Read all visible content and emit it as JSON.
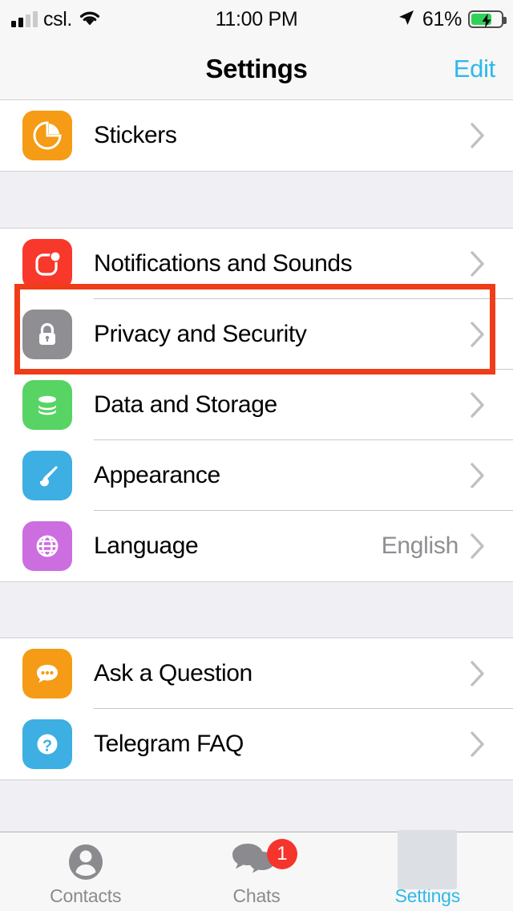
{
  "status_bar": {
    "carrier": "csl.",
    "signal_bars_filled": 2,
    "signal_bars_total": 4,
    "wifi_icon": "wifi-icon",
    "time": "11:00 PM",
    "location_icon": "location-arrow-icon",
    "battery_percent": "61%",
    "battery_level": 61,
    "battery_charging": true,
    "battery_color": "#30D158"
  },
  "nav": {
    "title": "Settings",
    "edit_label": "Edit",
    "accent_color": "#2EB9E8"
  },
  "sections": [
    {
      "rows": [
        {
          "icon": "sticker-icon",
          "icon_color": "#F59B15",
          "label": "Stickers",
          "detail": "",
          "accessory": "chevron-right-icon"
        }
      ]
    },
    {
      "rows": [
        {
          "icon": "notification-bell-icon",
          "icon_color": "#F8382B",
          "label": "Notifications and Sounds",
          "detail": "",
          "accessory": "chevron-right-icon"
        },
        {
          "icon": "lock-icon",
          "icon_color": "#8E8E93",
          "label": "Privacy and Security",
          "detail": "",
          "accessory": "chevron-right-icon"
        },
        {
          "icon": "database-icon",
          "icon_color": "#57D463",
          "label": "Data and Storage",
          "detail": "",
          "accessory": "chevron-right-icon"
        },
        {
          "icon": "paintbrush-icon",
          "icon_color": "#3DAFE3",
          "label": "Appearance",
          "detail": "",
          "accessory": "chevron-right-icon"
        },
        {
          "icon": "globe-icon",
          "icon_color": "#CC6EE0",
          "label": "Language",
          "detail": "English",
          "accessory": "chevron-right-icon"
        }
      ]
    },
    {
      "rows": [
        {
          "icon": "chat-bubble-icon",
          "icon_color": "#F59B15",
          "label": "Ask a Question",
          "detail": "",
          "accessory": "chevron-right-icon"
        },
        {
          "icon": "question-mark-icon",
          "icon_color": "#3DAFE3",
          "label": "Telegram FAQ",
          "detail": "",
          "accessory": "chevron-right-icon"
        }
      ]
    }
  ],
  "highlight": {
    "target_row": "Privacy and Security",
    "color": "#F03C18"
  },
  "tab_bar": {
    "tabs": [
      {
        "icon": "person-icon",
        "label": "Contacts",
        "active": false,
        "badge": ""
      },
      {
        "icon": "chats-bubbles-icon",
        "label": "Chats",
        "active": false,
        "badge": "1"
      },
      {
        "icon": "gear-icon",
        "label": "Settings",
        "active": true,
        "badge": ""
      }
    ],
    "active_color": "#2EB9E8",
    "inactive_color": "#8A8A8F",
    "badge_color": "#F5342B"
  }
}
